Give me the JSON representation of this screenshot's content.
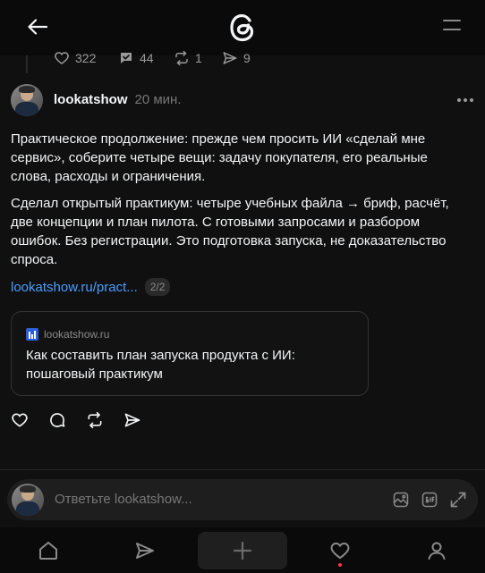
{
  "header": {
    "back_icon": "arrow-left-icon",
    "logo_icon": "threads-logo-icon",
    "menu_icon": "hamburger-icon"
  },
  "previous_post_stats": {
    "likes": "322",
    "replies": "44",
    "reposts": "1",
    "shares": "9"
  },
  "post": {
    "username": "lookatshow",
    "time": "20 мин.",
    "paragraph_1": "Практическое продолжение: прежде чем просить ИИ «сделай мне сервис», соберите четыре вещи: задачу покупателя, его реальные слова, расходы и ограничения.",
    "paragraph_2": "Сделал открытый практикум: четыре учебных файла → бриф, расчёт, две концепции и план пилота. С готовыми запросами и разбором ошибок. Без регистрации. Это подготовка запуска, не доказательство спроса.",
    "link_text": "lookatshow.ru/pract...",
    "page_indicator": "2/2",
    "card": {
      "domain": "lookatshow.ru",
      "title": "Как составить план запуска продукта с ИИ: пошаговый практикум"
    }
  },
  "reply": {
    "placeholder": "Ответьте lookatshow..."
  },
  "nav": {
    "items": [
      "home-icon",
      "send-icon",
      "plus-icon",
      "heart-icon",
      "profile-icon"
    ]
  },
  "colors": {
    "background": "#101010",
    "link": "#4a9eff",
    "notification_dot": "#ff3040"
  }
}
